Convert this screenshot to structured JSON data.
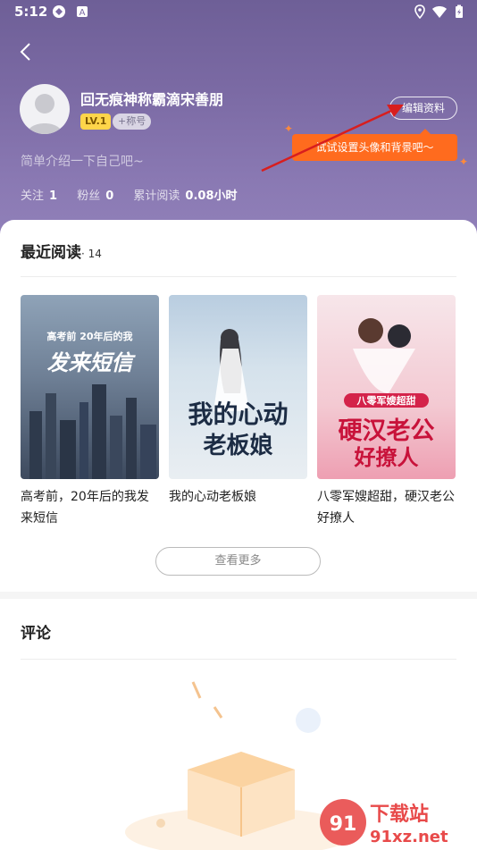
{
  "status_bar": {
    "time": "5:12"
  },
  "profile": {
    "username": "回无痕神称霸滴宋善朋",
    "level": "LV.1",
    "title_tag": "+称号",
    "edit_label": "编辑资料",
    "tooltip": "试试设置头像和背景吧～",
    "intro": "简单介绍一下自己吧~",
    "stats": [
      {
        "label": "关注",
        "value": "1"
      },
      {
        "label": "粉丝",
        "value": "0"
      },
      {
        "label": "累计阅读",
        "value": "0.08小时"
      }
    ]
  },
  "recent": {
    "title": "最近阅读",
    "count": "· 14",
    "books": [
      {
        "title": "高考前，20年后的我发来短信",
        "cover_lines": [
          "高考前 20年后的我",
          "发来短信"
        ],
        "cover_color": "#5a6d86"
      },
      {
        "title": "我的心动老板娘",
        "cover_lines": [
          "我的心动",
          "老板娘"
        ],
        "cover_color": "#9fb8cf"
      },
      {
        "title": "八零军嫂超甜，硬汉老公好撩人",
        "cover_lines": [
          "八零军嫂超甜",
          "硬汉老公",
          "好撩人"
        ],
        "cover_color": "#f3c9d2"
      }
    ],
    "more_label": "查看更多"
  },
  "comments": {
    "title": "评论"
  },
  "watermark": {
    "text": "下载站",
    "url": "91xz.net"
  },
  "icons": [
    "back-icon",
    "location-icon",
    "wifi-icon",
    "battery-icon"
  ],
  "accent": "#ff6b1e"
}
